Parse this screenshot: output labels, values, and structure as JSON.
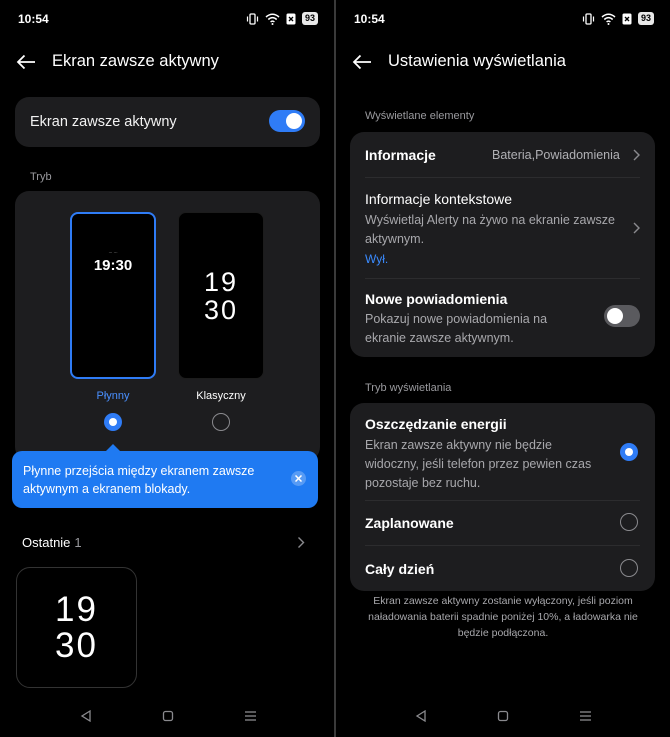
{
  "left": {
    "status": {
      "time": "10:54",
      "battery": "93"
    },
    "header": {
      "title": "Ekran zawsze aktywny"
    },
    "aod_toggle": {
      "label": "Ekran zawsze aktywny",
      "state": "on"
    },
    "mode_section": {
      "label": "Tryb"
    },
    "modes": [
      {
        "name": "Płynny",
        "preview_time": "19:30",
        "selected": true,
        "name_color": "#4a90ff"
      },
      {
        "name": "Klasyczny",
        "preview_hour": "19",
        "preview_min": "30",
        "selected": false,
        "name_color": "#ffffff"
      }
    ],
    "tooltip": {
      "text": "Płynne przejścia między ekranem zawsze aktywnym a ekranem blokady."
    },
    "recent": {
      "label": "Ostatnie",
      "count": "1",
      "thumb_hour": "19",
      "thumb_min": "30"
    }
  },
  "right": {
    "status": {
      "time": "10:54",
      "battery": "93"
    },
    "header": {
      "title": "Ustawienia wyświetlania"
    },
    "displayed_section": {
      "label": "Wyświetlane elementy"
    },
    "info_row": {
      "title": "Informacje",
      "value": "Bateria,Powiadomienia"
    },
    "context_row": {
      "title": "Informacje kontekstowe",
      "desc_line1": "Wyświetlaj Alerty na żywo na ekranie zawsze",
      "desc_line2": "aktywnym.",
      "status": "Wył."
    },
    "new_notif_row": {
      "title": "Nowe powiadomienia",
      "desc_line1": "Pokazuj nowe powiadomienia na",
      "desc_line2": "ekranie zawsze aktywnym.",
      "state": "off"
    },
    "mode_section": {
      "label": "Tryb wyświetlania"
    },
    "modes": [
      {
        "title": "Oszczędzanie energii",
        "desc_line1": "Ekran zawsze aktywny nie będzie",
        "desc_line2": "widoczny, jeśli telefon przez pewien czas",
        "desc_line3": "pozostaje bez ruchu.",
        "selected": true
      },
      {
        "title": "Zaplanowane",
        "selected": false
      },
      {
        "title": "Cały dzień",
        "selected": false
      }
    ],
    "footnote": "Ekran zawsze aktywny zostanie wyłączony, jeśli poziom naładowania baterii spadnie poniżej 10%, a ładowarka nie będzie podłączona."
  },
  "colors": {
    "accent": "#2f7cf6",
    "card": "#1d1d1f",
    "background": "#000000",
    "tooltip": "#1f7af2"
  },
  "icons": [
    "back-arrow-icon",
    "vibrate-icon",
    "wifi-icon",
    "sim-x-icon",
    "chevron-right-icon",
    "close-icon",
    "nav-back-icon",
    "nav-home-icon",
    "nav-recents-icon"
  ]
}
